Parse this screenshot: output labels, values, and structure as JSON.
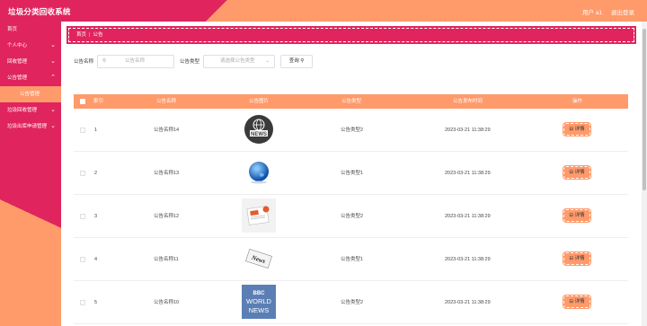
{
  "header": {
    "title": "垃圾分类回收系统",
    "user": "用户 a1",
    "logout": "退出登录"
  },
  "sidebar": {
    "items": [
      {
        "label": "首页",
        "chevron": false
      },
      {
        "label": "个人中心",
        "chevron": true
      },
      {
        "label": "回收管理",
        "chevron": true
      },
      {
        "label": "公告管理",
        "chevron": true
      },
      {
        "label": "公告管理",
        "chevron": false,
        "sub": true
      },
      {
        "label": "垃圾回收管理",
        "chevron": true
      },
      {
        "label": "垃圾出库申请管理",
        "chevron": true
      }
    ]
  },
  "breadcrumb": {
    "home": "首页",
    "current": "公告"
  },
  "search": {
    "name_label": "公告名称",
    "name_placeholder": "公告名称",
    "type_label": "公告类型",
    "type_placeholder": "请选择公告类型",
    "search_button": "查询"
  },
  "table": {
    "headers": [
      "索引",
      "公告名称",
      "公告图片",
      "公告类型",
      "公告发布时间",
      "操作"
    ],
    "rows": [
      {
        "index": "1",
        "name": "公告名称14",
        "image": "news-sign-icon",
        "type": "公告类型2",
        "time": "2023-03-21 11:38:29",
        "action": "详情"
      },
      {
        "index": "2",
        "name": "公告名称13",
        "image": "globe-icon",
        "type": "公告类型1",
        "time": "2023-03-21 11:38:29",
        "action": "详情"
      },
      {
        "index": "3",
        "name": "公告名称12",
        "image": "newspaper-icon",
        "type": "公告类型2",
        "time": "2023-03-21 11:38:29",
        "action": "详情"
      },
      {
        "index": "4",
        "name": "公告名称11",
        "image": "news-paper-roll-icon",
        "type": "公告类型1",
        "time": "2023-03-21 11:38:29",
        "action": "详情"
      },
      {
        "index": "5",
        "name": "公告名称10",
        "image": "bbc-world-news-icon",
        "type": "公告类型2",
        "time": "2023-03-21 11:38:29",
        "action": "详情"
      }
    ]
  },
  "images": {
    "news_sign_text": "NEWS",
    "paper_roll_text": "News",
    "bbc_text": "BBC",
    "world_text": "WORLD",
    "news_text": "NEWS"
  },
  "colors": {
    "primary": "#e0245e",
    "accent": "#ff9a6b"
  }
}
